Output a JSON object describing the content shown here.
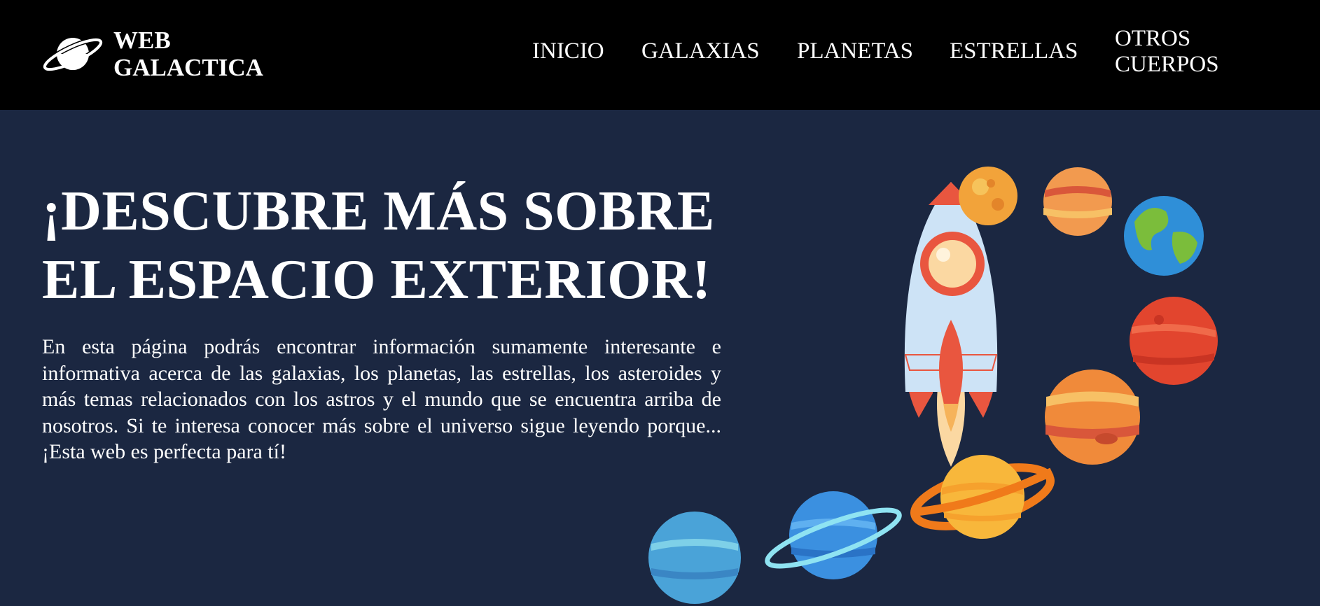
{
  "brand": {
    "logo_icon": "planet-icon",
    "name_line1": "WEB",
    "name_line2": "GALACTICA"
  },
  "nav": {
    "items": [
      {
        "label": "INICIO"
      },
      {
        "label": "GALAXIAS"
      },
      {
        "label": "PLANETAS"
      },
      {
        "label": "ESTRELLAS"
      },
      {
        "label_line1": "OTROS",
        "label_line2": "CUERPOS"
      }
    ]
  },
  "hero": {
    "title_line1": "¡DESCUBRE MÁS SOBRE",
    "title_line2": "EL ESPACIO EXTERIOR!",
    "intro": "En esta página podrás encontrar información sumamente interesante e informativa acerca de las galaxias, los planetas, las estrellas, los asteroides y más temas relacionados con los astros y el mundo que se encuentra arriba de nosotros. Si te interesa conocer más sobre el universo sigue leyendo porque... ¡Esta web es perfecta para tí!",
    "illustration_icon": "rocket-and-planets-illustration"
  },
  "colors": {
    "header_bg": "#000000",
    "page_bg": "#1b2741",
    "text": "#ffffff"
  }
}
